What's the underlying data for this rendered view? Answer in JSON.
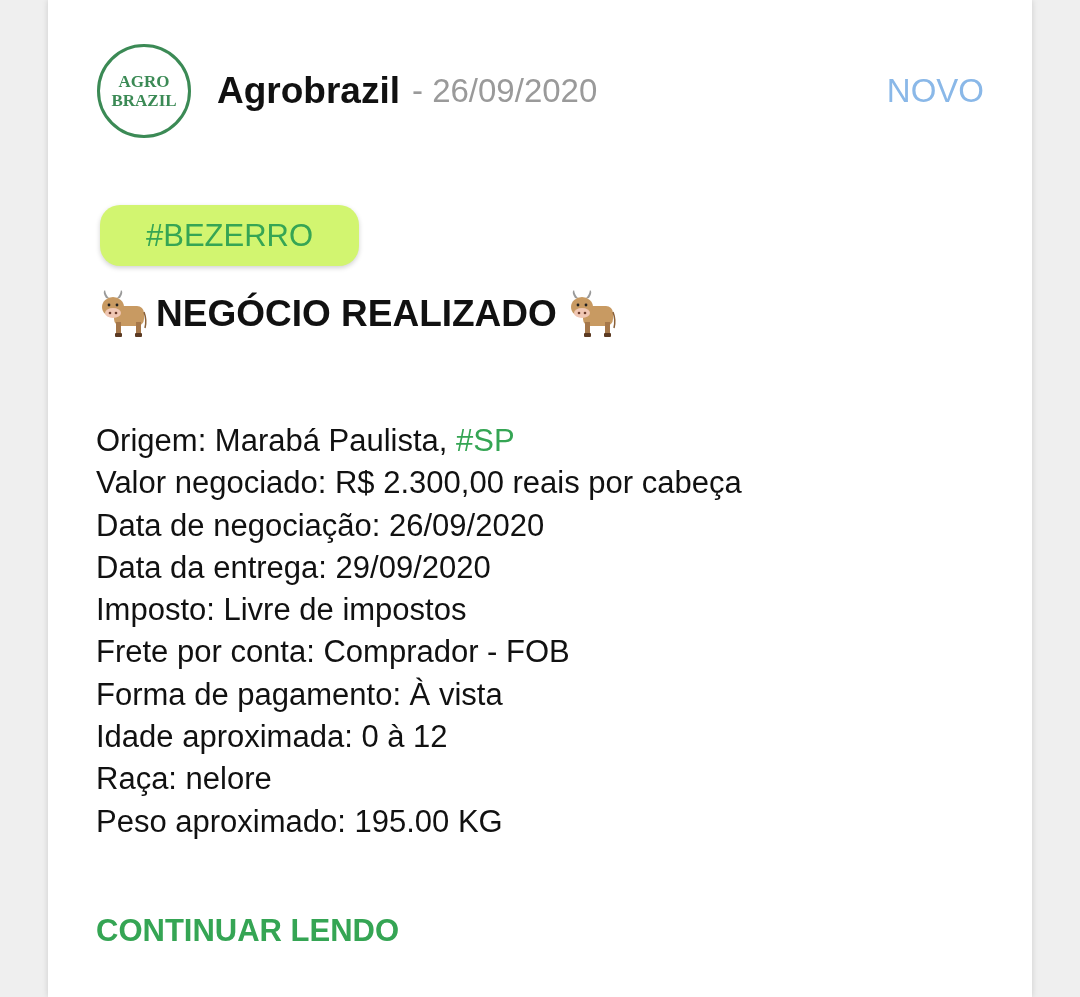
{
  "post": {
    "logo_lines": [
      "AGRO",
      "BRAZIL"
    ],
    "author": "Agrobrazil",
    "date": "- 26/09/2020",
    "badge": "NOVO",
    "tag": "#BEZERRO",
    "headline": "NEGÓCIO REALIZADO",
    "details": [
      {
        "text": "Origem: Marabá Paulista,",
        "hashtag": "#SP"
      },
      {
        "text": "Valor negociado: R$ 2.300,00 reais por cabeça"
      },
      {
        "text": "Data de negociação: 26/09/2020"
      },
      {
        "text": "Data da entrega: 29/09/2020"
      },
      {
        "text": "Imposto: Livre de impostos"
      },
      {
        "text": "Frete por conta: Comprador - FOB"
      },
      {
        "text": "Forma de pagamento: À vista"
      },
      {
        "text": "Idade aproximada: 0 à 12"
      },
      {
        "text": "Raça: nelore"
      },
      {
        "text": "Peso aproximado: 195.00 KG"
      }
    ],
    "read_more": "CONTINUAR LENDO"
  }
}
